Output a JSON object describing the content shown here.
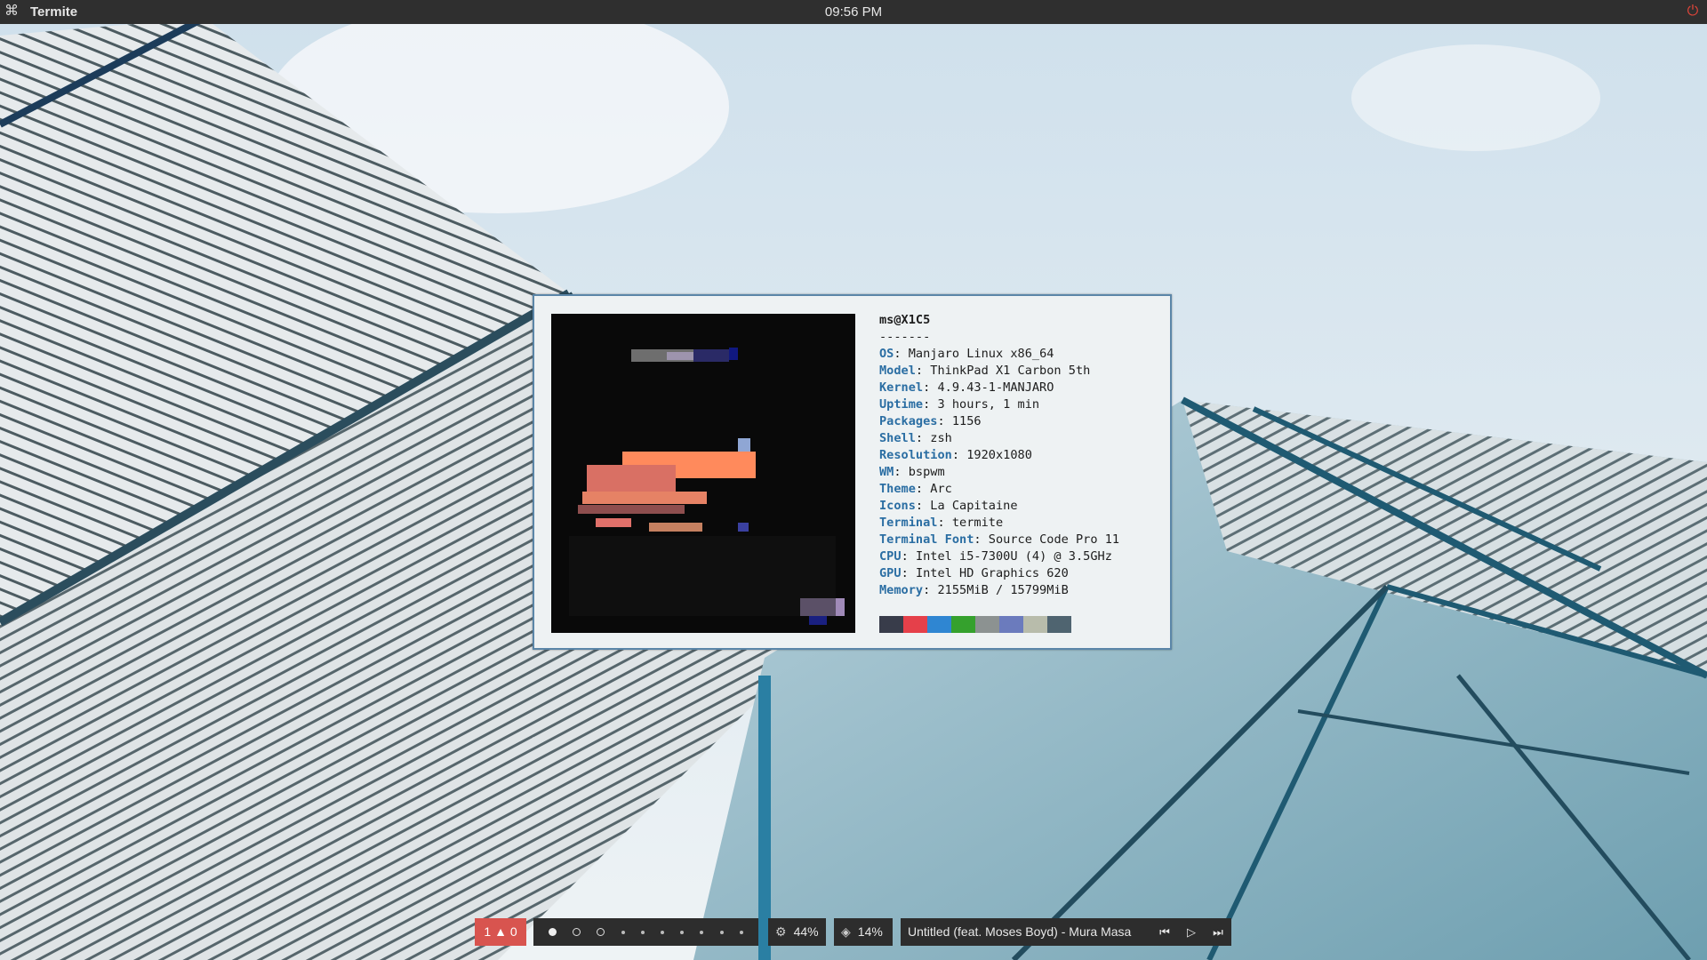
{
  "topbar": {
    "app_name": "Termite",
    "app_icon": "command-icon",
    "clock": "09:56 PM",
    "power_icon": "power-icon"
  },
  "terminal": {
    "user_host": "ms@X1C5",
    "separator": "-------",
    "info": [
      {
        "key": "OS",
        "value": "Manjaro Linux x86_64"
      },
      {
        "key": "Model",
        "value": "ThinkPad X1 Carbon 5th"
      },
      {
        "key": "Kernel",
        "value": "4.9.43-1-MANJARO"
      },
      {
        "key": "Uptime",
        "value": "3 hours, 1 min"
      },
      {
        "key": "Packages",
        "value": "1156"
      },
      {
        "key": "Shell",
        "value": "zsh"
      },
      {
        "key": "Resolution",
        "value": "1920x1080"
      },
      {
        "key": "WM",
        "value": "bspwm"
      },
      {
        "key": "Theme",
        "value": "Arc"
      },
      {
        "key": "Icons",
        "value": "La Capitaine"
      },
      {
        "key": "Terminal",
        "value": "termite"
      },
      {
        "key": "Terminal Font",
        "value": "Source Code Pro 11"
      },
      {
        "key": "CPU",
        "value": "Intel i5-7300U (4) @ 3.5GHz"
      },
      {
        "key": "GPU",
        "value": "Intel HD Graphics 620"
      },
      {
        "key": "Memory",
        "value": "2155MiB / 15799MiB"
      }
    ],
    "palette": [
      "#383c4a",
      "#e5404a",
      "#2f86d2",
      "#35a12d",
      "#8c9291",
      "#6b7bbd",
      "#b8bcab",
      "#4f6470"
    ],
    "key_color": "#2b6ea3"
  },
  "bottombar": {
    "alerts": "1",
    "alerts_count": "0",
    "alerts_icon": "bell-icon",
    "workspaces": [
      "active",
      "ring",
      "ring",
      "dot",
      "dot",
      "dot",
      "dot",
      "dot",
      "dot",
      "dot"
    ],
    "cpu": "44%",
    "cpu_icon": "cpu-icon",
    "memory": "14%",
    "memory_icon": "layers-icon",
    "now_playing": "Untitled (feat. Moses Boyd) - Mura Masa",
    "prev_icon": "skip-back-icon",
    "play_icon": "play-icon",
    "next_icon": "skip-forward-icon"
  }
}
